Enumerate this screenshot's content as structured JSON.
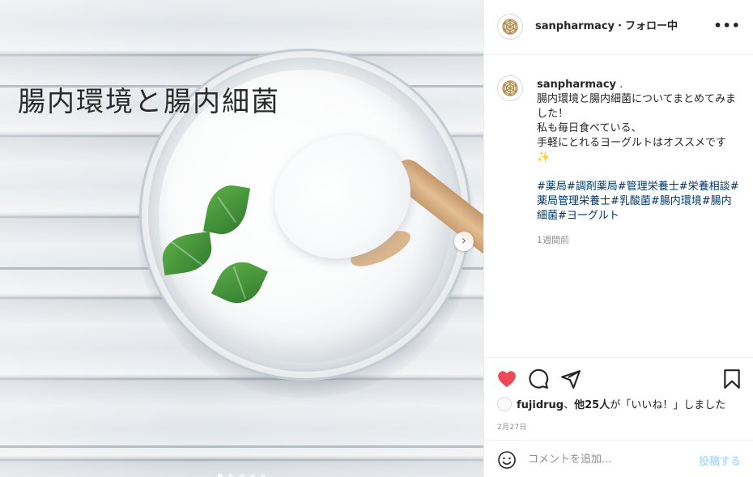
{
  "post": {
    "overlay_title": "腸内環境と腸内細菌"
  },
  "header": {
    "username": "sanpharmacy",
    "separator": "・",
    "follow_label": "フォロー中",
    "more_icon": "more-horizontal-icon"
  },
  "caption": {
    "username": "sanpharmacy",
    "username_suffix": ".",
    "body": "腸内環境と腸内細菌についてまとめてみました！\n私も毎日食べている、\n手軽にとれるヨーグルトはオススメです✨",
    "hashtags": "#薬局#調剤薬局#管理栄養士#栄養相談#薬局管理栄養士#乳酸菌#腸内環境#腸内細菌#ヨーグルト",
    "time_ago": "1週間前"
  },
  "actions": {
    "like_icon": "heart-filled-icon",
    "comment_icon": "comment-icon",
    "share_icon": "send-icon",
    "save_icon": "bookmark-icon",
    "like_color": "#ed4956"
  },
  "likes": {
    "user": "fujidrug",
    "sep": "、",
    "others": "他25人",
    "suffix": "が「いいね！」しました"
  },
  "post_date": "2月27日",
  "comment": {
    "placeholder": "コメントを追加...",
    "post_label": "投稿する"
  },
  "carousel": {
    "total": 5,
    "current": 1
  }
}
